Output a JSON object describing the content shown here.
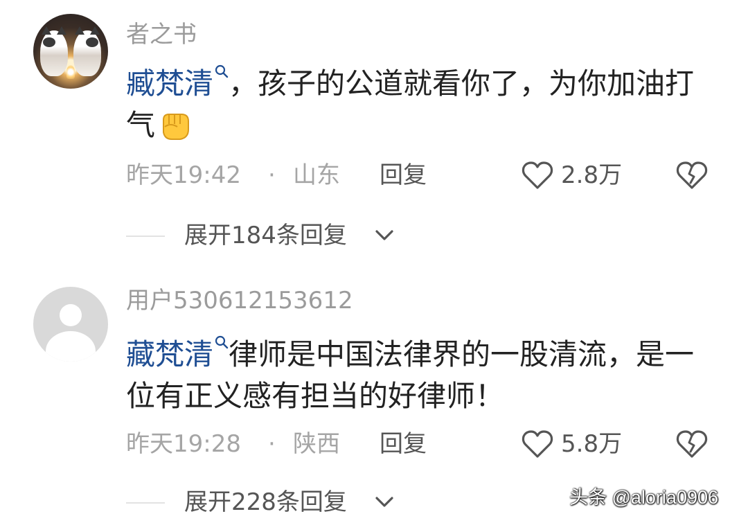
{
  "comments": [
    {
      "username": "者之书",
      "mention": "臧梵清",
      "text": "，孩子的公道就看你了，为你加油打气",
      "emoji": "fist-icon",
      "time": "昨天19:42",
      "separator": "·",
      "location": "山东",
      "reply_label": "回复",
      "like_count": "2.8万",
      "expand_label": "展开184条回复"
    },
    {
      "username": "用户530612153612",
      "mention": "藏梵清",
      "text": "律师是中国法律界的一股清流，是一位有正义感有担当的好律师！",
      "time": "昨天19:28",
      "separator": "·",
      "location": "陕西",
      "reply_label": "回复",
      "like_count": "5.8万",
      "expand_label": "展开228条回复"
    }
  ],
  "watermark": "头条 @aloria0906",
  "colors": {
    "mention": "#1f4e93",
    "muted_text": "#9b9b9b",
    "body_text": "#222222",
    "action_text": "#555555",
    "divider": "#e2e2e2"
  }
}
